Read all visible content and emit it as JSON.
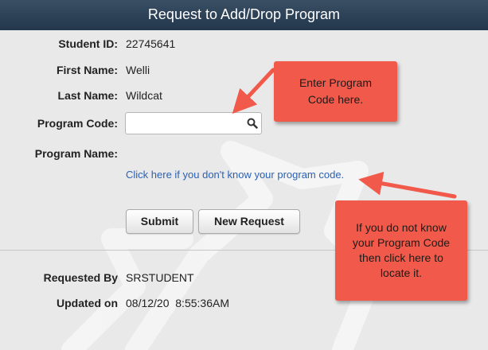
{
  "header": {
    "title": "Request to Add/Drop Program"
  },
  "form": {
    "student_id": {
      "label": "Student ID:",
      "value": "22745641"
    },
    "first_name": {
      "label": "First Name:",
      "value": "Welli"
    },
    "last_name": {
      "label": "Last Name:",
      "value": "Wildcat"
    },
    "program_code": {
      "label": "Program Code:",
      "value": "",
      "placeholder": ""
    },
    "program_name": {
      "label": "Program Name:",
      "value": ""
    },
    "lookup_link": "Click here if you don't know your program code."
  },
  "buttons": {
    "submit": "Submit",
    "new_request": "New Request"
  },
  "footer": {
    "requested_by": {
      "label": "Requested By",
      "value": "SRSTUDENT"
    },
    "updated_on": {
      "label": "Updated on",
      "value": "08/12/20  8:55:36AM"
    }
  },
  "callouts": {
    "program_code": "Enter Program\nCode here.",
    "lookup": "If you do not know\nyour Program Code\nthen click here to\nlocate it."
  },
  "colors": {
    "header_top": "#3a4f64",
    "header_bottom": "#22374b",
    "background": "#e9e9e9",
    "link": "#2b61b3",
    "callout": "#f15a4a"
  }
}
